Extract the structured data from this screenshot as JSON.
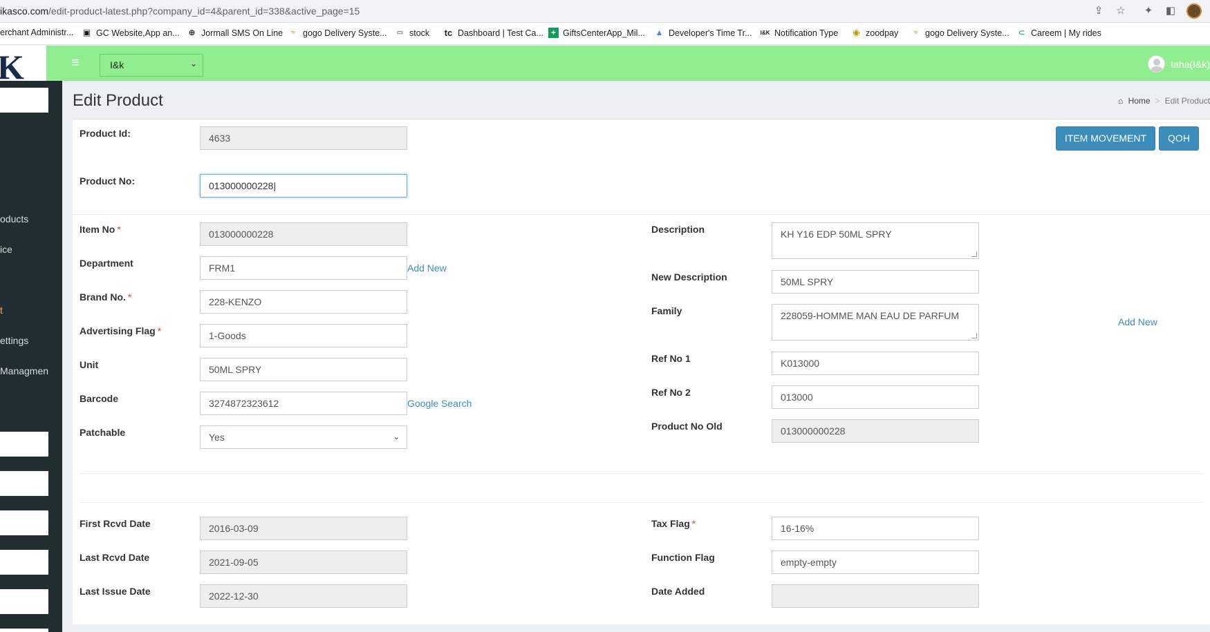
{
  "browser": {
    "url_host": "ikasco.com",
    "url_path": "/edit-product-latest.php?company_id=4&parent_id=338&active_page=15",
    "bookmarks": [
      {
        "label": "erchant Administr...",
        "icon": ""
      },
      {
        "label": "GC Website,App an...",
        "icon": "trello-icon"
      },
      {
        "label": "Jormall SMS On Line",
        "icon": "globe-icon"
      },
      {
        "label": "gogo Delivery Syste...",
        "icon": "gogo-icon"
      },
      {
        "label": "stock",
        "icon": "code-icon"
      },
      {
        "label": "Dashboard | Test Ca...",
        "icon": "tc-icon"
      },
      {
        "label": "GiftsCenterApp_Mil...",
        "icon": "sheets-icon"
      },
      {
        "label": "Developer's Time Tr...",
        "icon": "drive-icon"
      },
      {
        "label": "Notification Type",
        "icon": "ik-icon"
      },
      {
        "label": "zoodpay",
        "icon": "zoodpay-icon"
      },
      {
        "label": "gogo Delivery Syste...",
        "icon": "gogo-icon"
      },
      {
        "label": "Careem | My rides",
        "icon": "careem-icon"
      }
    ]
  },
  "header": {
    "company": "I&k",
    "user": "taha(I&k)"
  },
  "sidebar": {
    "items": [
      "oducts",
      "ice",
      "t",
      "ettings",
      "Managmen"
    ]
  },
  "page": {
    "title": "Edit Product",
    "breadcrumb_home": "Home",
    "breadcrumb_current": "Edit Product"
  },
  "buttons": {
    "item_movement": "ITEM MOVEMENT",
    "qoh": "QOH"
  },
  "fields": {
    "product_id": {
      "label": "Product Id:",
      "value": "4633"
    },
    "product_no": {
      "label": "Product No:",
      "value": "013000000228"
    },
    "item_no": {
      "label": "Item No",
      "value": "013000000228"
    },
    "department": {
      "label": "Department",
      "value": "FRM1"
    },
    "brand_no": {
      "label": "Brand No.",
      "value": "228-KENZO"
    },
    "advertising_flag": {
      "label": "Advertising Flag",
      "value": "1-Goods"
    },
    "unit": {
      "label": "Unit",
      "value": "50ML SPRY"
    },
    "barcode": {
      "label": "Barcode",
      "value": "3274872323612"
    },
    "patchable": {
      "label": "Patchable",
      "value": "Yes"
    },
    "description": {
      "label": "Description",
      "value": "KH Y16 EDP 50ML SPRY"
    },
    "new_description": {
      "label": "New Description",
      "value": "50ML SPRY"
    },
    "family": {
      "label": "Family",
      "value": "228059-HOMME MAN EAU DE PARFUM"
    },
    "ref_no_1": {
      "label": "Ref No 1",
      "value": "K013000"
    },
    "ref_no_2": {
      "label": "Ref No 2",
      "value": "013000"
    },
    "product_no_old": {
      "label": "Product No Old",
      "value": "013000000228"
    },
    "first_rcvd_date": {
      "label": "First Rcvd Date",
      "value": "2016-03-09"
    },
    "last_rcvd_date": {
      "label": "Last Rcvd Date",
      "value": "2021-09-05"
    },
    "last_issue_date": {
      "label": "Last Issue Date",
      "value": "2022-12-30"
    },
    "tax_flag": {
      "label": "Tax Flag",
      "value": "16-16%"
    },
    "function_flag": {
      "label": "Function Flag",
      "value": "empty-empty"
    },
    "date_added": {
      "label": "Date Added",
      "value": ""
    }
  },
  "links": {
    "add_new_department": "Add New",
    "google_search": "Google Search",
    "add_new_family": "Add New"
  },
  "required_marker": "*"
}
